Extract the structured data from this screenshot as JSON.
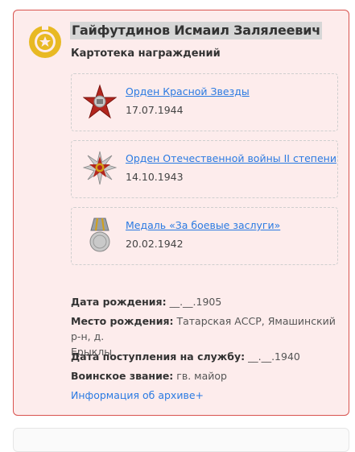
{
  "person": {
    "name": "Гайфутдинов Исмаил Залялеевич",
    "section_title": "Картотека награждений"
  },
  "awards": [
    {
      "title": "Орден Красной Звезды",
      "date": "17.07.1944",
      "icon": "red-star-order-icon"
    },
    {
      "title": "Орден Отечественной войны II степени",
      "date": "14.10.1943",
      "icon": "patriotic-war-order-icon"
    },
    {
      "title": "Медаль «За боевые заслуги»",
      "date": "20.02.1942",
      "icon": "combat-merit-medal-icon"
    }
  ],
  "details": {
    "birth_date_label": "Дата рождения:",
    "birth_date_value": "__.__.1905",
    "birth_place_label": "Место рождения:",
    "birth_place_value_line1": "Татарская АССР, Ямашинский р-н, д.",
    "birth_place_value_line2": "Ерыклы",
    "service_date_label": "Дата поступления на службу:",
    "service_date_value": "__.__.1940",
    "rank_label": "Воинское звание:",
    "rank_value": "гв. майор"
  },
  "archive_link": "Информация об архиве+",
  "colors": {
    "card_bg": "#fdecec",
    "card_border": "#d9534f",
    "link": "#2a7ae2",
    "seal": "#e8b923"
  }
}
